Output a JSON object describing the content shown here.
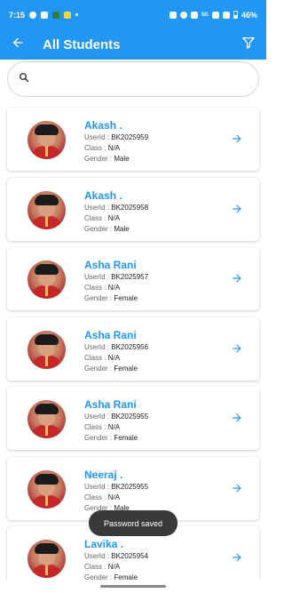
{
  "status_bar": {
    "time": "7:15",
    "net_text": "5G",
    "battery": "46%"
  },
  "app_bar": {
    "title": "All Students"
  },
  "search": {
    "placeholder": ""
  },
  "labels": {
    "userid": "UserId :",
    "class": "Class :",
    "gender": "Gender :"
  },
  "students": [
    {
      "name": "Akash  .",
      "userid": "BK2025959",
      "class": "N/A",
      "gender": "Male"
    },
    {
      "name": "Akash  .",
      "userid": "BK2025958",
      "class": "N/A",
      "gender": "Male"
    },
    {
      "name": "Asha  Rani",
      "userid": "BK2025957",
      "class": "N/A",
      "gender": "Female"
    },
    {
      "name": "Asha  Rani",
      "userid": "BK2025956",
      "class": "N/A",
      "gender": "Female"
    },
    {
      "name": "Asha  Rani",
      "userid": "BK2025955",
      "class": "N/A",
      "gender": "Female"
    },
    {
      "name": "Neeraj  .",
      "userid": "BK2025955",
      "class": "N/A",
      "gender": "Male"
    },
    {
      "name": "Lavika  .",
      "userid": "BK2025954",
      "class": "N/A",
      "gender": "Female"
    }
  ],
  "toast": {
    "message": "Password saved"
  },
  "colors": {
    "primary": "#2196f3",
    "name_text": "#2196f3",
    "toast_bg": "#3a3a3a"
  },
  "icons": [
    "back-arrow-icon",
    "filter-icon",
    "search-icon",
    "chevron-right-arrow-icon"
  ]
}
